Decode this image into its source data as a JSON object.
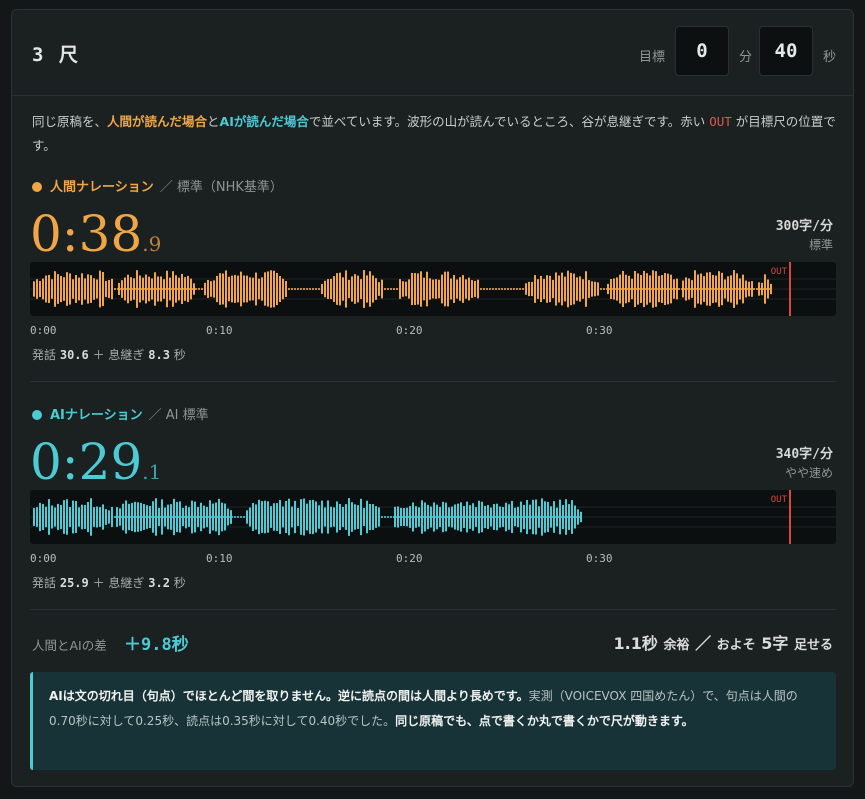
{
  "header": {
    "title": "3 尺",
    "target_label": "目標",
    "minutes": "0",
    "minutes_unit": "分",
    "seconds": "40",
    "seconds_unit": "秒"
  },
  "intro": {
    "p1": "同じ原稿を、",
    "human": "人間が読んだ場合",
    "p2": "と",
    "ai": "AIが読んだ場合",
    "p3": "で並べています。波形の山が読んでいるところ、谷が息継ぎです。赤い ",
    "out": "OUT",
    "p4": " が目標尺の位置です。"
  },
  "human": {
    "name": "人間ナレーション",
    "standard": "／ 標準（NHK基準）",
    "time_main": "0:38",
    "time_frac": ".9",
    "rate": "300字/分",
    "rate_label": "標準",
    "out_label": "OUT",
    "ticks": [
      "0:00",
      "0:10",
      "0:20",
      "0:30"
    ],
    "speech_label": "発話",
    "speech": "30.6",
    "plus": "＋",
    "breath_label": "息継ぎ",
    "breath": "8.3",
    "sec": "秒",
    "color": "#f0a646",
    "duration": 38.9
  },
  "ai": {
    "name": "AIナレーション",
    "standard": "／ AI 標準",
    "time_main": "0:29",
    "time_frac": ".1",
    "rate": "340字/分",
    "rate_label": "やや速め",
    "out_label": "OUT",
    "ticks": [
      "0:00",
      "0:10",
      "0:20",
      "0:30"
    ],
    "speech_label": "発話",
    "speech": "25.9",
    "plus": "＋",
    "breath_label": "息継ぎ",
    "breath": "3.2",
    "sec": "秒",
    "color": "#4ccbd5",
    "duration": 29.1
  },
  "target_seconds": 40,
  "diff": {
    "label": "人間とAIの差",
    "value": "＋9.8秒",
    "margin_num": "1.1秒",
    "margin_word": "余裕",
    "sep": "／",
    "approx": "およそ",
    "chars_num": "5字",
    "chars_word": "足せる"
  },
  "note": {
    "b1": "AIは文の切れ目（句点）でほとんど間を取りません。逆に読点の間は人間より長めです。",
    "t1": "実測（VOICEVOX 四国めたん）で、句点は人間の0.70秒に対して0.25秒、読点は0.35秒に対して0.40秒でした。",
    "b2": "同じ原稿でも、点で書くか丸で書くかで尺が動きます。"
  }
}
